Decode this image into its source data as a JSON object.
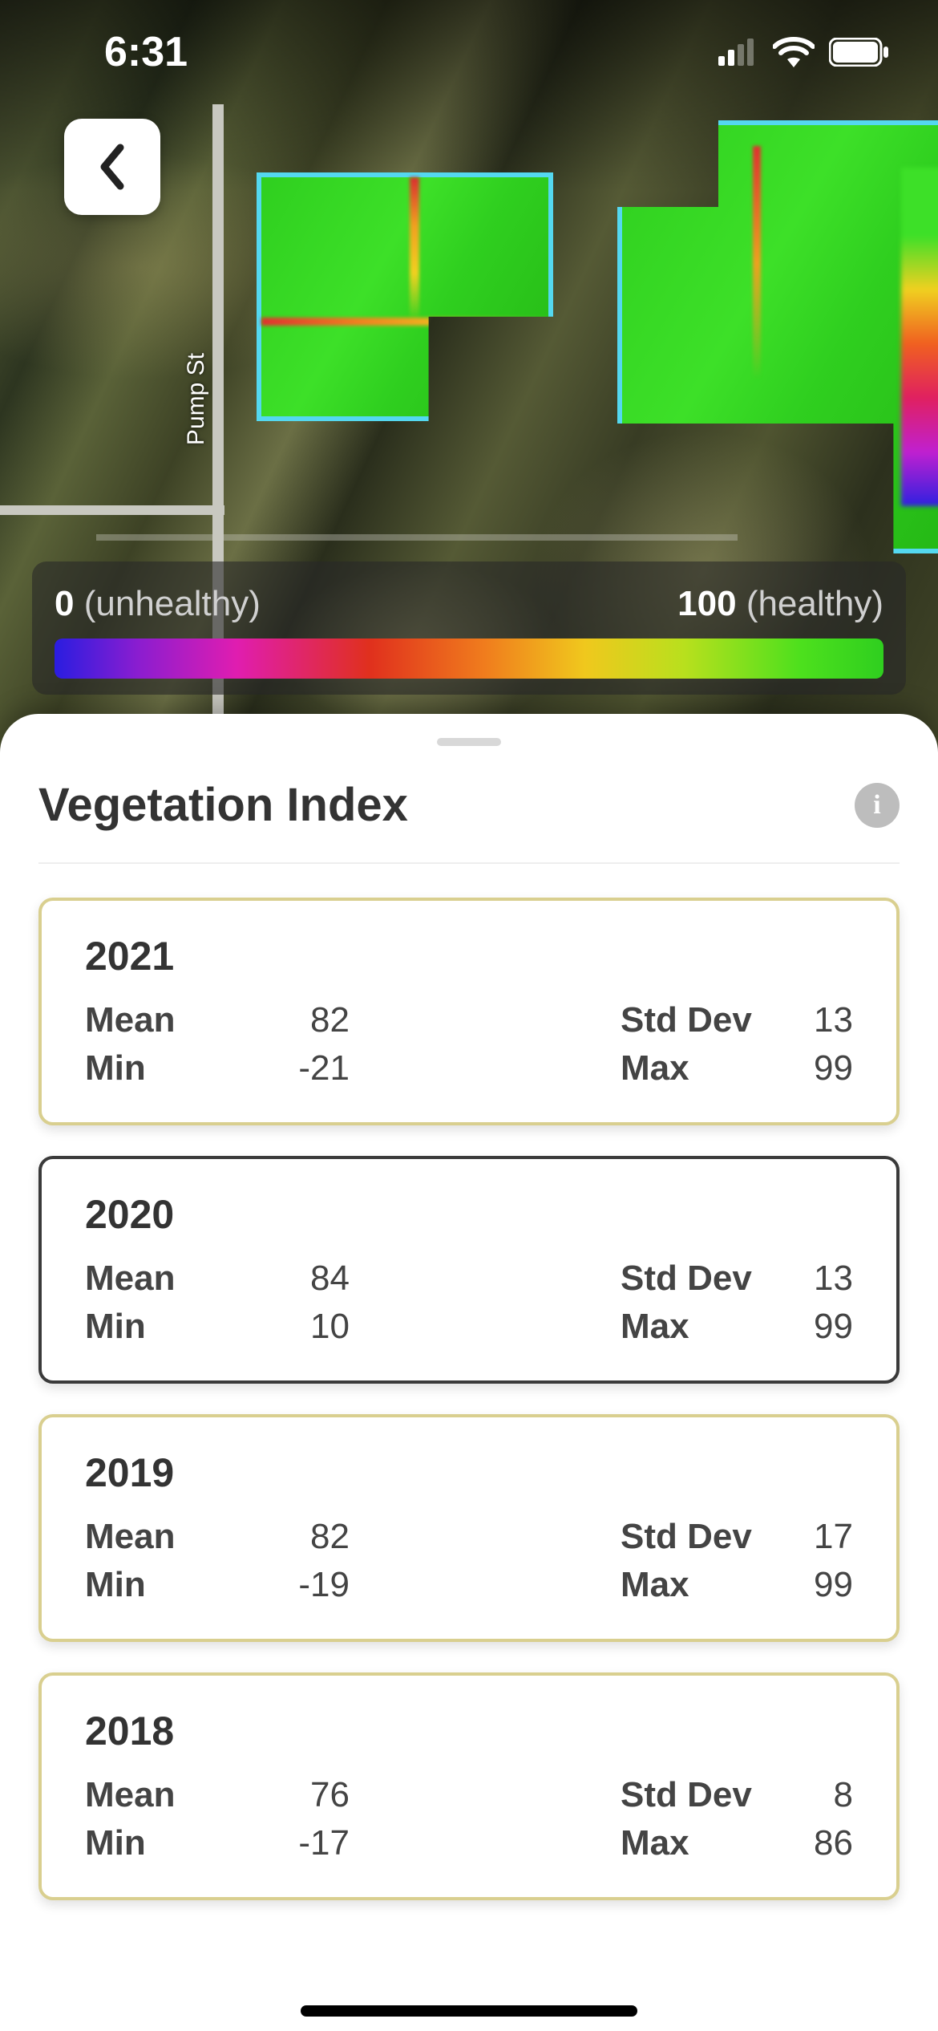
{
  "status": {
    "time": "6:31"
  },
  "map": {
    "road_label": "Pump St",
    "legend": {
      "low_value": "0",
      "low_label": "(unhealthy)",
      "high_value": "100",
      "high_label": "(healthy)"
    }
  },
  "sheet": {
    "title": "Vegetation Index",
    "stat_labels": {
      "mean": "Mean",
      "min": "Min",
      "stddev": "Std Dev",
      "max": "Max"
    },
    "years": [
      {
        "year": "2021",
        "mean": "82",
        "min": "-21",
        "stddev": "13",
        "max": "99",
        "highlight": false
      },
      {
        "year": "2020",
        "mean": "84",
        "min": "10",
        "stddev": "13",
        "max": "99",
        "highlight": true
      },
      {
        "year": "2019",
        "mean": "82",
        "min": "-19",
        "stddev": "17",
        "max": "99",
        "highlight": false
      },
      {
        "year": "2018",
        "mean": "76",
        "min": "-17",
        "stddev": "8",
        "max": "86",
        "highlight": false
      }
    ]
  }
}
